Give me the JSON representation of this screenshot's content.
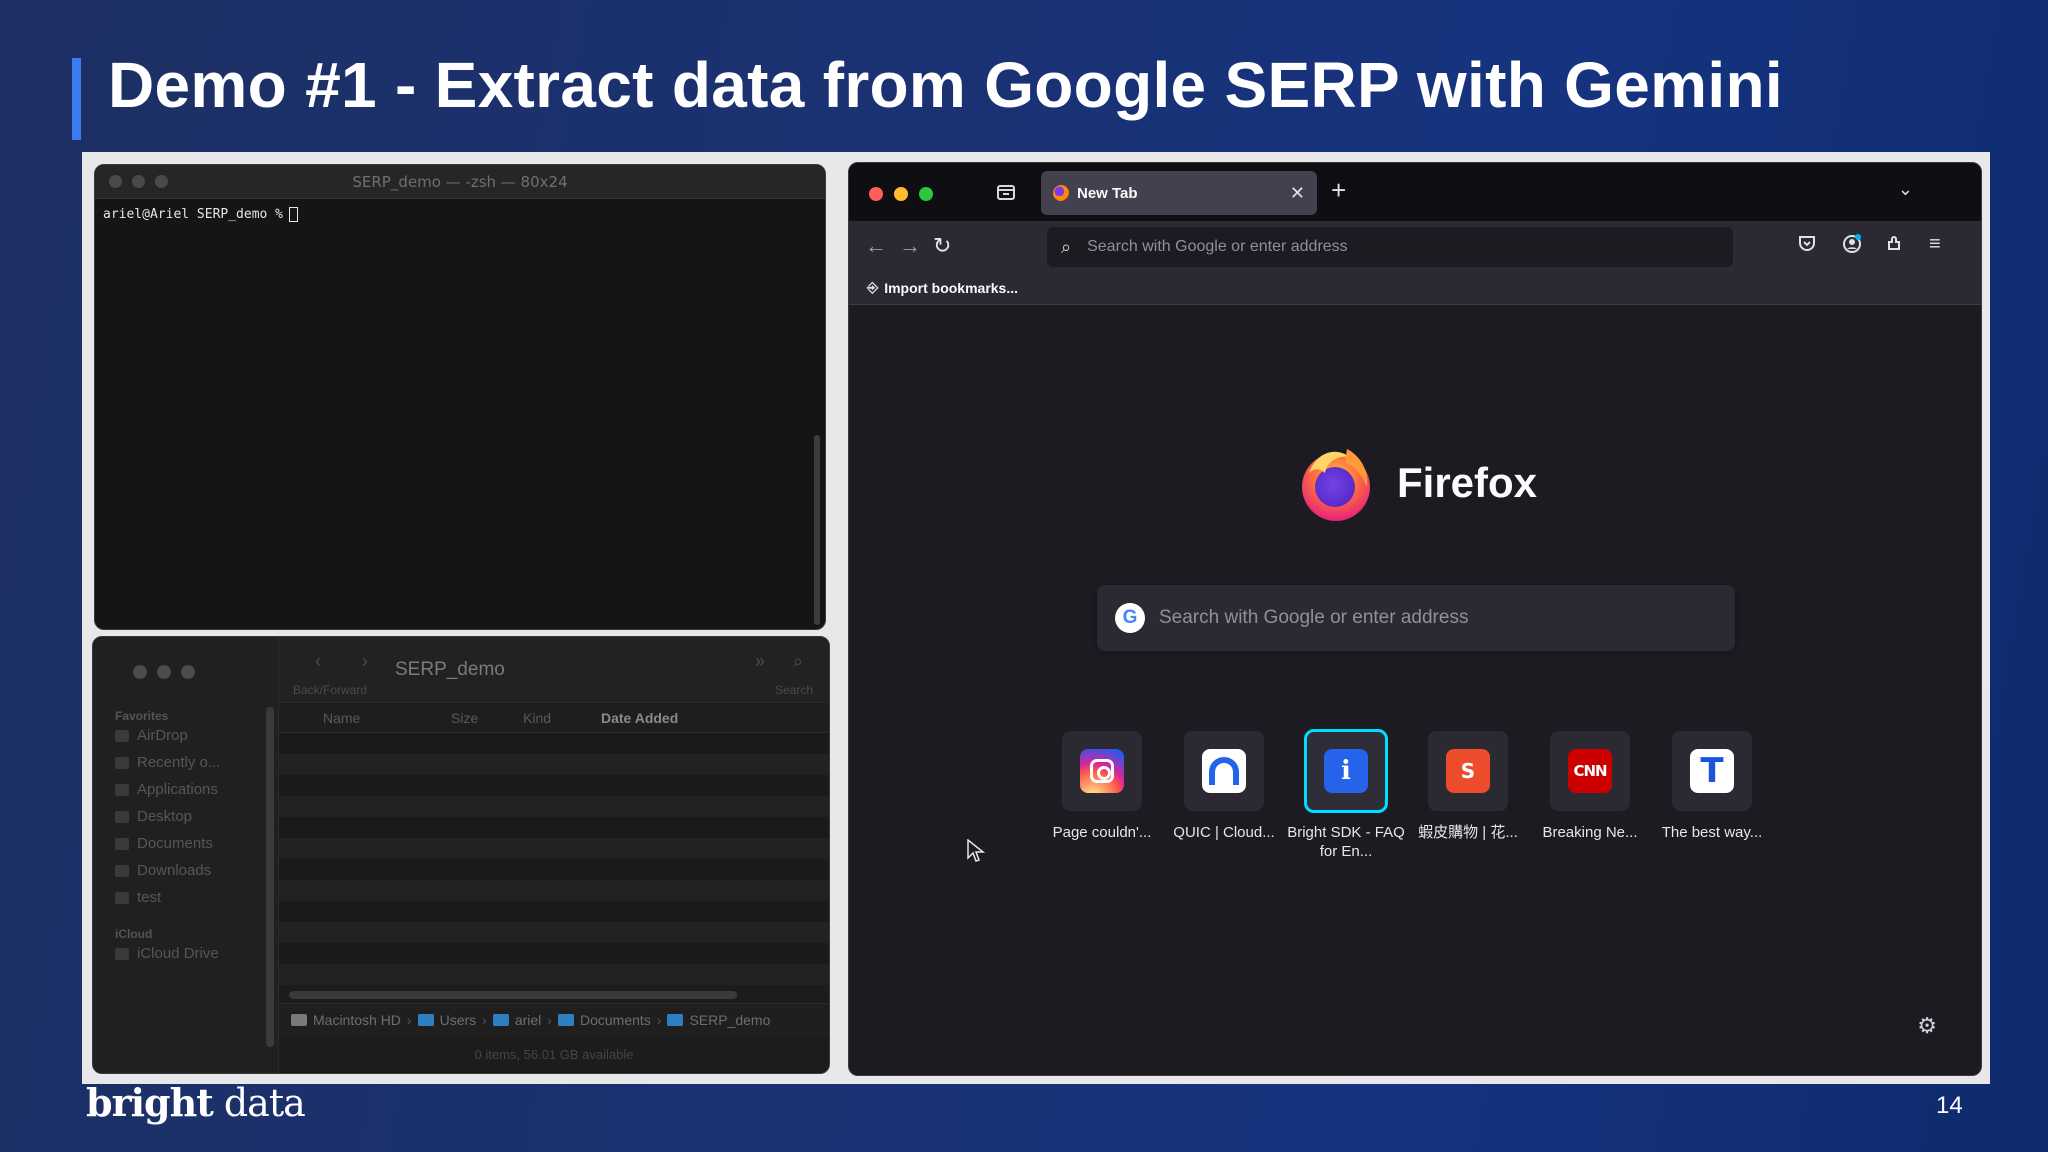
{
  "slide": {
    "title": "Demo #1 - Extract data from Google SERP with Gemini",
    "page_number": "14",
    "brand_bold": "bright",
    "brand_light": " data",
    "accent_color": "#3d7cf0"
  },
  "terminal": {
    "title": "SERP_demo — -zsh — 80x24",
    "prompt": "ariel@Ariel SERP_demo % "
  },
  "finder": {
    "title": "SERP_demo",
    "back_forward_label": "Back/Forward",
    "search_label": "Search",
    "favorites_label": "Favorites",
    "favorites": [
      {
        "label": "AirDrop",
        "icon": "airdrop-icon"
      },
      {
        "label": "Recently o...",
        "icon": "clock-icon"
      },
      {
        "label": "Applications",
        "icon": "applications-icon"
      },
      {
        "label": "Desktop",
        "icon": "desktop-icon"
      },
      {
        "label": "Documents",
        "icon": "document-icon"
      },
      {
        "label": "Downloads",
        "icon": "download-icon"
      },
      {
        "label": "test",
        "icon": "tag-icon"
      }
    ],
    "icloud_label": "iCloud",
    "icloud_items": [
      {
        "label": "iCloud Drive",
        "icon": "cloud-icon"
      }
    ],
    "columns": {
      "name": "Name",
      "size": "Size",
      "kind": "Kind",
      "date_added": "Date Added"
    },
    "path": [
      "Macintosh HD",
      "Users",
      "ariel",
      "Documents",
      "SERP_demo"
    ],
    "status": "0 items, 56.01 GB available"
  },
  "firefox": {
    "tab_title": "New Tab",
    "url_placeholder": "Search with Google or enter address",
    "import_bookmarks": "Import bookmarks...",
    "wordmark": "Firefox",
    "search_placeholder": "Search with Google or enter address",
    "shortcuts": [
      {
        "label": "Page couldn'...",
        "icon": "instagram-icon"
      },
      {
        "label": "QUIC | Cloud...",
        "icon": "cloudflare-icon"
      },
      {
        "label": "Bright SDK - FAQ for En...",
        "icon": "info-icon"
      },
      {
        "label": "蝦皮購物 | 花...",
        "icon": "shopee-icon"
      },
      {
        "label": "Breaking Ne...",
        "icon": "cnn-icon"
      },
      {
        "label": "The best way...",
        "icon": "t-icon"
      }
    ],
    "colors": {
      "selected_outline": "#00ddff",
      "tab_active": "#42414d"
    }
  }
}
